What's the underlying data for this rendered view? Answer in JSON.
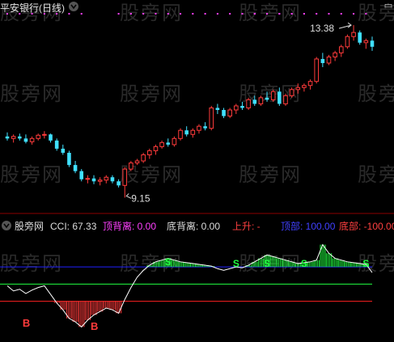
{
  "header": {
    "title": "平安银行(日线)",
    "price_high_label": "13.38",
    "price_low_label": "9.15"
  },
  "indicator_bar": {
    "name": "股旁网",
    "cci_label": "CCI: 67.33",
    "top_div_label": "顶背离: 0.00",
    "bottom_div_label": "底背离: 0.00",
    "rise_label": "上升: -",
    "top_label": "顶部: 100.00",
    "bottom_label": "底部: -100.00"
  },
  "watermark": "股旁网",
  "signals": {
    "buy": "B",
    "sell": "S"
  },
  "colors": {
    "up": "#ff3b3b",
    "down": "#40e0ff",
    "magenta": "#ff40ff",
    "green": "#20ff40",
    "blue_line": "#2020ff",
    "red_line": "#ff2020",
    "cci_line": "#ffffff"
  },
  "chart_data": [
    {
      "type": "candlestick",
      "title": "平安银行(日线)",
      "annotations": [
        {
          "text": "13.38",
          "value": 13.38
        },
        {
          "text": "9.15",
          "value": 9.15
        }
      ],
      "candles": [
        [
          10.65,
          10.75,
          10.55,
          10.6
        ],
        [
          10.6,
          10.7,
          10.5,
          10.65
        ],
        [
          10.65,
          10.72,
          10.55,
          10.6
        ],
        [
          10.6,
          10.7,
          10.48,
          10.52
        ],
        [
          10.52,
          10.65,
          10.45,
          10.6
        ],
        [
          10.6,
          10.72,
          10.55,
          10.68
        ],
        [
          10.68,
          10.78,
          10.6,
          10.7
        ],
        [
          10.7,
          10.72,
          10.5,
          10.55
        ],
        [
          10.55,
          10.6,
          10.3,
          10.35
        ],
        [
          10.35,
          10.45,
          10.2,
          10.25
        ],
        [
          10.25,
          10.3,
          9.9,
          9.95
        ],
        [
          9.95,
          10.05,
          9.75,
          9.8
        ],
        [
          9.8,
          9.85,
          9.55,
          9.6
        ],
        [
          9.6,
          9.7,
          9.5,
          9.62
        ],
        [
          9.62,
          9.7,
          9.48,
          9.55
        ],
        [
          9.55,
          9.65,
          9.45,
          9.58
        ],
        [
          9.58,
          9.7,
          9.5,
          9.65
        ],
        [
          9.65,
          9.7,
          9.5,
          9.55
        ],
        [
          9.55,
          9.6,
          9.4,
          9.45
        ],
        [
          9.45,
          9.9,
          9.15,
          9.85
        ],
        [
          9.85,
          10.05,
          9.8,
          10.0
        ],
        [
          10.0,
          10.1,
          9.95,
          10.05
        ],
        [
          10.05,
          10.25,
          10.0,
          10.2
        ],
        [
          10.2,
          10.35,
          10.1,
          10.3
        ],
        [
          10.3,
          10.45,
          10.2,
          10.4
        ],
        [
          10.4,
          10.55,
          10.35,
          10.5
        ],
        [
          10.5,
          10.6,
          10.4,
          10.45
        ],
        [
          10.45,
          10.65,
          10.4,
          10.6
        ],
        [
          10.6,
          10.85,
          10.55,
          10.8
        ],
        [
          10.8,
          10.9,
          10.65,
          10.7
        ],
        [
          10.7,
          10.85,
          10.62,
          10.8
        ],
        [
          10.8,
          10.95,
          10.72,
          10.9
        ],
        [
          10.9,
          11.0,
          10.8,
          10.85
        ],
        [
          10.85,
          11.4,
          10.8,
          11.35
        ],
        [
          11.35,
          11.45,
          11.2,
          11.3
        ],
        [
          11.3,
          11.35,
          11.1,
          11.15
        ],
        [
          11.15,
          11.35,
          11.1,
          11.3
        ],
        [
          11.3,
          11.45,
          11.2,
          11.4
        ],
        [
          11.4,
          11.5,
          11.3,
          11.35
        ],
        [
          11.35,
          11.6,
          11.3,
          11.55
        ],
        [
          11.55,
          11.65,
          11.4,
          11.45
        ],
        [
          11.45,
          11.65,
          11.4,
          11.6
        ],
        [
          11.6,
          11.75,
          11.5,
          11.55
        ],
        [
          11.55,
          11.8,
          11.5,
          11.75
        ],
        [
          11.75,
          11.85,
          11.4,
          11.45
        ],
        [
          11.45,
          11.7,
          11.4,
          11.65
        ],
        [
          11.65,
          11.85,
          11.6,
          11.8
        ],
        [
          11.8,
          11.95,
          11.7,
          11.85
        ],
        [
          11.85,
          11.95,
          11.75,
          11.9
        ],
        [
          11.9,
          12.05,
          11.8,
          12.0
        ],
        [
          12.0,
          12.6,
          11.95,
          12.55
        ],
        [
          12.55,
          12.7,
          12.35,
          12.45
        ],
        [
          12.45,
          12.65,
          12.4,
          12.6
        ],
        [
          12.6,
          12.75,
          12.5,
          12.7
        ],
        [
          12.7,
          12.9,
          12.6,
          12.85
        ],
        [
          12.85,
          13.15,
          12.8,
          13.1
        ],
        [
          13.1,
          13.38,
          13.0,
          13.2
        ],
        [
          13.2,
          13.25,
          12.9,
          12.95
        ],
        [
          12.95,
          13.05,
          12.8,
          13.0
        ],
        [
          13.0,
          13.1,
          12.75,
          12.85
        ]
      ]
    },
    {
      "type": "line",
      "title": "股旁网",
      "series": [
        {
          "name": "CCI",
          "values": [
            -10,
            -40,
            -30,
            -55,
            -35,
            -20,
            -10,
            -60,
            -110,
            -150,
            -200,
            -220,
            -250,
            -210,
            -180,
            -160,
            -140,
            -150,
            -170,
            -90,
            -20,
            40,
            80,
            110,
            130,
            140,
            150,
            140,
            130,
            125,
            120,
            115,
            110,
            105,
            90,
            80,
            90,
            100,
            95,
            110,
            130,
            150,
            170,
            160,
            150,
            140,
            130,
            120,
            125,
            130,
            140,
            230,
            180,
            150,
            140,
            130,
            125,
            120,
            115,
            67.33
          ]
        }
      ],
      "levels": [
        {
          "name": "顶部",
          "value": 100
        },
        {
          "name": "底部",
          "value": -100
        },
        {
          "name": "",
          "value": 0
        }
      ],
      "ylim": [
        -300,
        280
      ]
    }
  ]
}
